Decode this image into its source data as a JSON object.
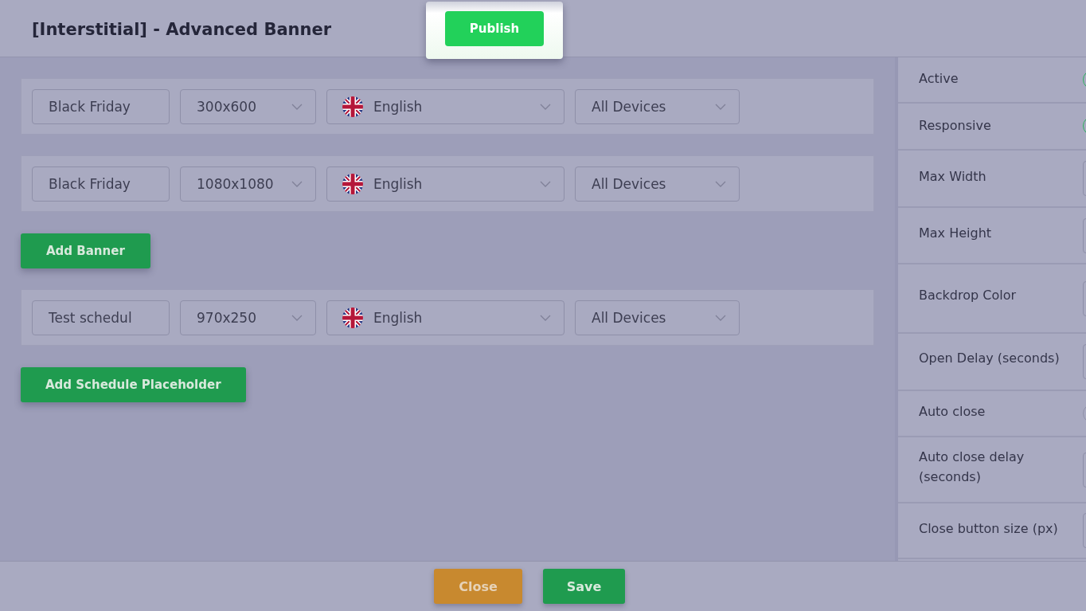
{
  "window": {
    "title": "[Interstitial] - Advanced Banner"
  },
  "publish_button": "Publish",
  "sections": [
    {
      "kind": "banners",
      "rows": [
        {
          "name": "Black Friday",
          "size": "300x600",
          "language": "English",
          "devices": "All Devices"
        },
        {
          "name": "Black Friday",
          "size": "1080x1080",
          "language": "English",
          "devices": "All Devices"
        }
      ],
      "button": "Add Banner"
    },
    {
      "kind": "schedule",
      "rows": [
        {
          "name": "Test schedul",
          "size": "970x250",
          "language": "English",
          "devices": "All Devices"
        }
      ],
      "button": "Add Schedule Placeholder"
    }
  ],
  "settings": [
    {
      "label": "Active",
      "kind": "toggle",
      "on": true
    },
    {
      "label": "Responsive",
      "kind": "toggle",
      "on": true
    },
    {
      "label": "Max Width",
      "kind": "input"
    },
    {
      "label": "Max Height",
      "kind": "input"
    },
    {
      "label": "Backdrop Color",
      "kind": "input"
    },
    {
      "label": "Open Delay (seconds)",
      "kind": "input"
    },
    {
      "label": "Auto close",
      "kind": "toggle",
      "on": false
    },
    {
      "label": "Auto close delay (seconds)",
      "kind": "input"
    },
    {
      "label": "Close button size (px)",
      "kind": "input"
    }
  ],
  "footer": {
    "close": "Close",
    "save": "Save"
  }
}
